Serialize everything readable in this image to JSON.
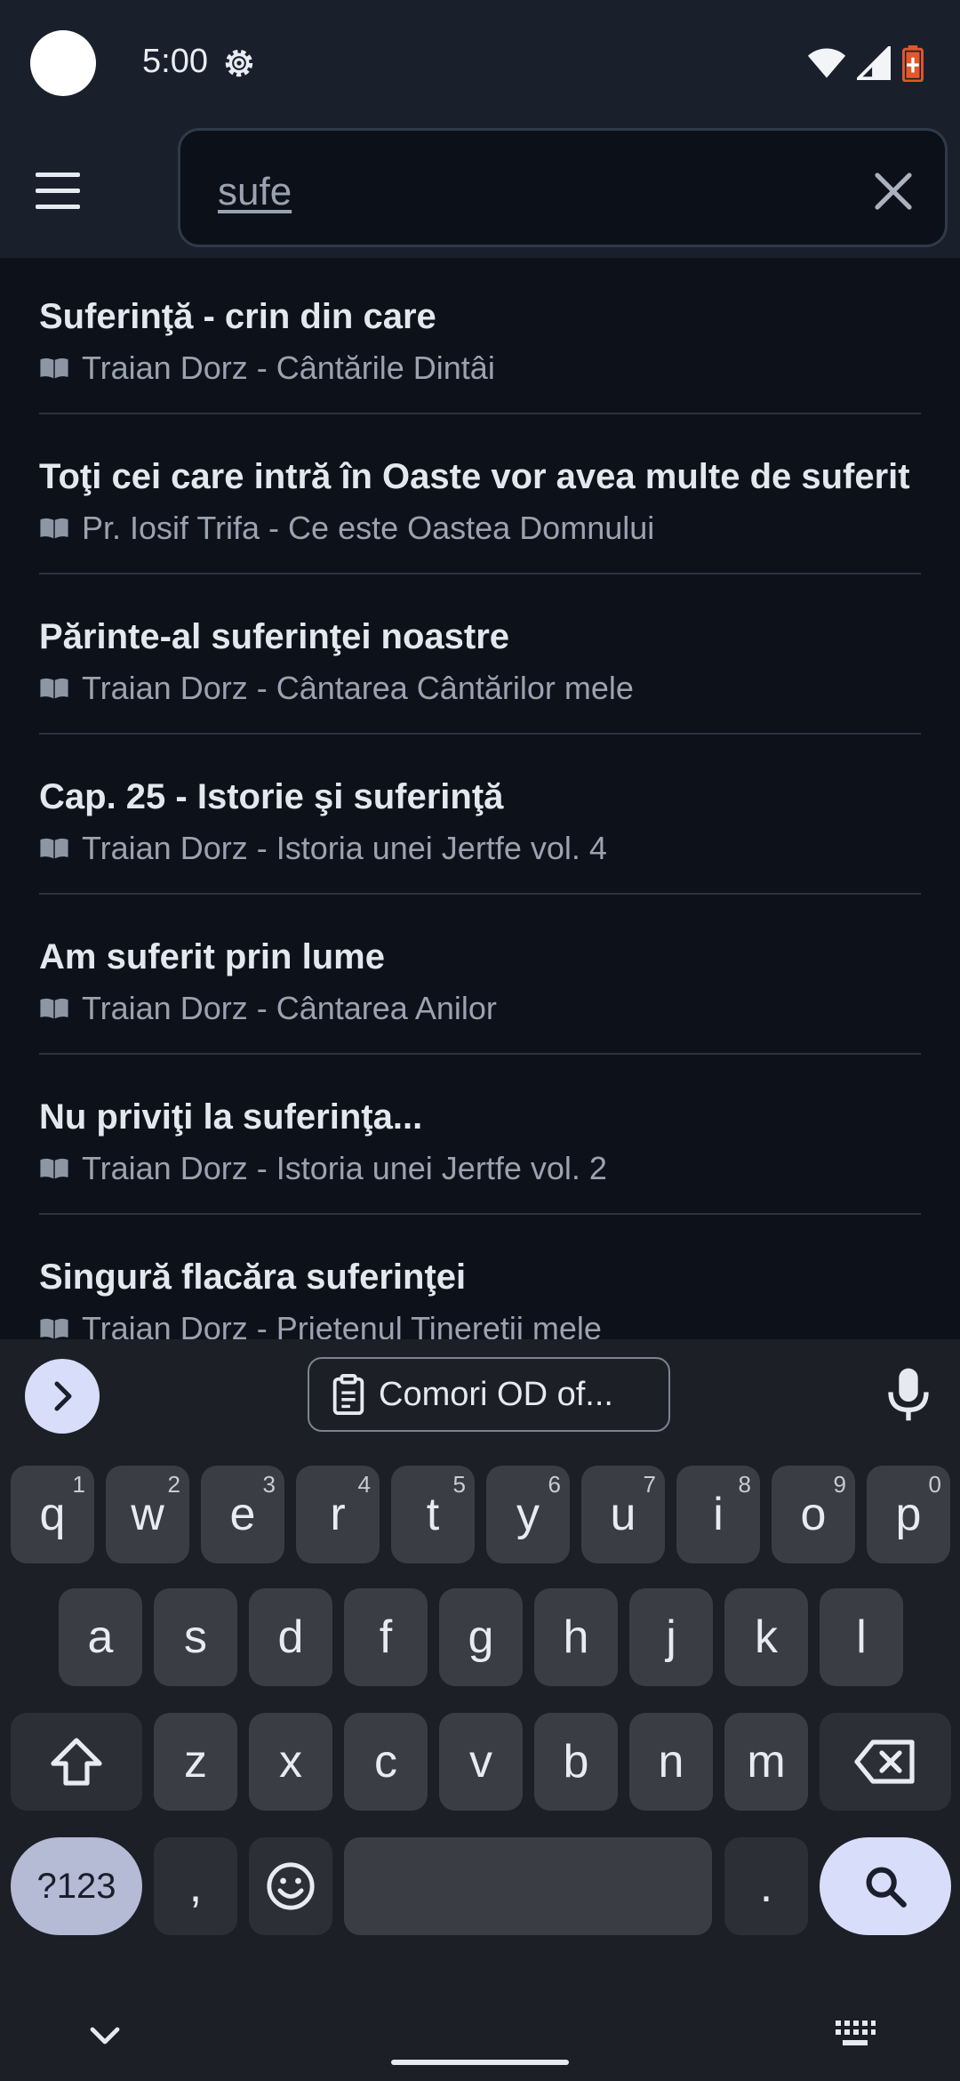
{
  "status_bar": {
    "time": "5:00"
  },
  "search": {
    "value": "sufe"
  },
  "results": [
    {
      "title": "Suferinţă - crin din care",
      "source": "Traian Dorz - Cântările Dintâi"
    },
    {
      "title": "Toţi cei care intră în Oaste vor avea multe de suferit",
      "source": "Pr. Iosif Trifa - Ce este Oastea Domnului"
    },
    {
      "title": "Părinte-al suferinţei noastre",
      "source": "Traian Dorz - Cântarea Cântărilor mele"
    },
    {
      "title": "Cap. 25 - Istorie şi suferinţă",
      "source": "Traian Dorz - Istoria unei Jertfe vol. 4"
    },
    {
      "title": "Am suferit prin lume",
      "source": "Traian Dorz - Cântarea Anilor"
    },
    {
      "title": "Nu priviţi la suferinţa...",
      "source": "Traian Dorz - Istoria unei Jertfe vol. 2"
    },
    {
      "title": "Singură flacăra suferinţei",
      "source": "Traian Dorz - Prietenul Tinereţii mele"
    }
  ],
  "keyboard": {
    "clipboard_chip": "Comori OD of...",
    "row1": [
      {
        "k": "q",
        "h": "1"
      },
      {
        "k": "w",
        "h": "2"
      },
      {
        "k": "e",
        "h": "3"
      },
      {
        "k": "r",
        "h": "4"
      },
      {
        "k": "t",
        "h": "5"
      },
      {
        "k": "y",
        "h": "6"
      },
      {
        "k": "u",
        "h": "7"
      },
      {
        "k": "i",
        "h": "8"
      },
      {
        "k": "o",
        "h": "9"
      },
      {
        "k": "p",
        "h": "0"
      }
    ],
    "row2": [
      "a",
      "s",
      "d",
      "f",
      "g",
      "h",
      "j",
      "k",
      "l"
    ],
    "row3": [
      "z",
      "x",
      "c",
      "v",
      "b",
      "n",
      "m"
    ],
    "num_key": "?123",
    "comma": ",",
    "period": "."
  },
  "colors": {
    "accent": "#d8ddf9",
    "background": "#0d111a",
    "appbar": "#1a202b",
    "battery": "#e2572b"
  }
}
